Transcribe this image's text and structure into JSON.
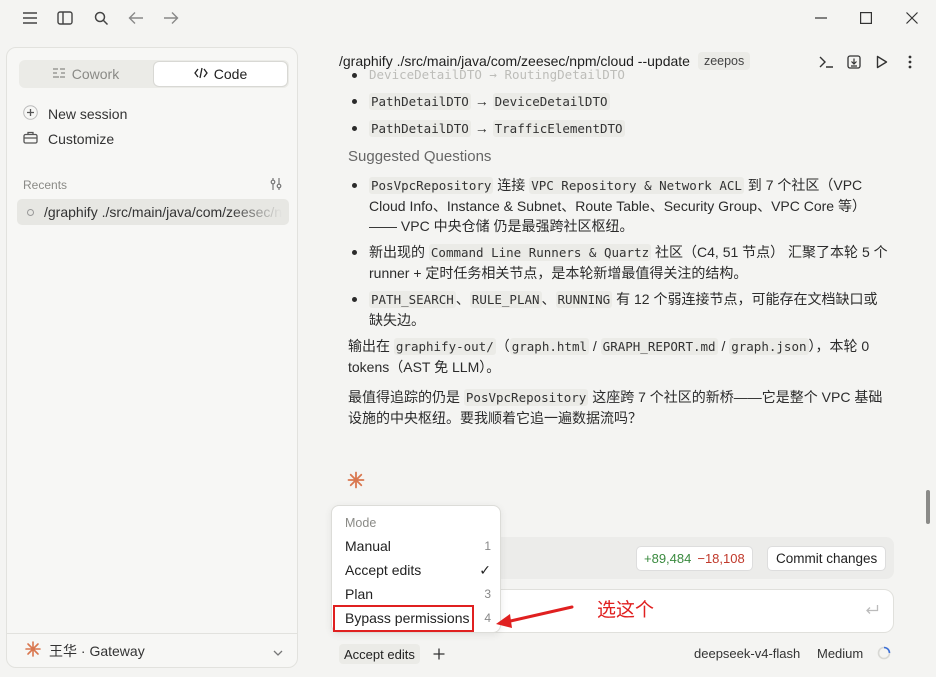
{
  "titlebar": {
    "icons": [
      "menu-icon",
      "sidebar-toggle-icon",
      "search-icon",
      "back-icon",
      "forward-icon"
    ],
    "window_controls": [
      "minimize-icon",
      "maximize-icon",
      "close-icon"
    ]
  },
  "sidebar": {
    "tabs": [
      {
        "label": "Cowork",
        "icon": "cowork-icon",
        "active": false
      },
      {
        "label": "Code",
        "icon": "code-icon",
        "active": true
      }
    ],
    "actions": [
      {
        "label": "New session",
        "icon": "plus-icon"
      },
      {
        "label": "Customize",
        "icon": "briefcase-icon"
      }
    ],
    "recents_label": "Recents",
    "recent_items": [
      {
        "label": "/graphify ./src/main/java/com/zeesec/n"
      }
    ],
    "user": {
      "label": "王华 · Gateway"
    }
  },
  "main": {
    "command": "/graphify ./src/main/java/com/zeesec/npm/cloud --update",
    "tag": "zeepos",
    "faded_line": "DeviceDetailDTO → RoutingDetailDTO",
    "mapping_items": [
      {
        "from": "PathDetailDTO",
        "arrow": "→",
        "to": "DeviceDetailDTO"
      },
      {
        "from": "PathDetailDTO",
        "arrow": "→",
        "to": "TrafficElementDTO"
      }
    ],
    "suggested_heading": "Suggested Questions",
    "suggested": [
      {
        "code1": "PosVpcRepository",
        "t1": " 连接 ",
        "code2": "VPC Repository & Network ACL",
        "t2": " 到 7 个社区（VPC Cloud Info、Instance & Subnet、Route Table、Security Group、VPC Core 等）—— VPC 中央仓储 仍是最强跨社区枢纽。"
      },
      {
        "t0": "新出现的 ",
        "code1": "Command Line Runners & Quartz",
        "t1": " 社区（C4, 51 节点） 汇聚了本轮 5 个 runner + 定时任务相关节点，是本轮新增最值得关注的结构。"
      },
      {
        "code1": "PATH_SEARCH",
        "s1": "、",
        "code2": "RULE_PLAN",
        "s2": "、",
        "code3": "RUNNING",
        "t1": " 有 12 个弱连接节点，可能存在文档缺口或缺失边。"
      }
    ],
    "output_para": {
      "t0": "输出在 ",
      "c1": "graphify-out/",
      "t1": "（",
      "c2": "graph.html",
      "s1": " / ",
      "c3": "GRAPH_REPORT.md",
      "s2": " / ",
      "c4": "graph.json",
      "t2": "），本轮 0 tokens（AST 免 LLM）。"
    },
    "closing_para": {
      "t0": "最值得追踪的仍是 ",
      "c1": "PosVpcRepository",
      "t1": " 这座跨 7 个社区的新桥——它是整个 VPC 基础设施的中央枢纽。要我顺着它追一遍数据流吗？"
    }
  },
  "changes": {
    "additions": "+89,484",
    "deletions": "−18,108",
    "commit_label": "Commit changes"
  },
  "mode_menu": {
    "title": "Mode",
    "items": [
      {
        "label": "Manual",
        "key": "1"
      },
      {
        "label": "Accept edits",
        "key": "✓"
      },
      {
        "label": "Plan",
        "key": "3"
      },
      {
        "label": "Bypass permissions",
        "key": "4"
      }
    ]
  },
  "bottom_bar": {
    "mode_button": "Accept edits",
    "model": "deepseek-v4-flash",
    "effort": "Medium"
  },
  "annotation": {
    "text": "选这个",
    "color": "#e02020"
  },
  "colors": {
    "accent_spark": "#d9774f",
    "additions": "#3a8a3f",
    "deletions": "#c0392b"
  }
}
